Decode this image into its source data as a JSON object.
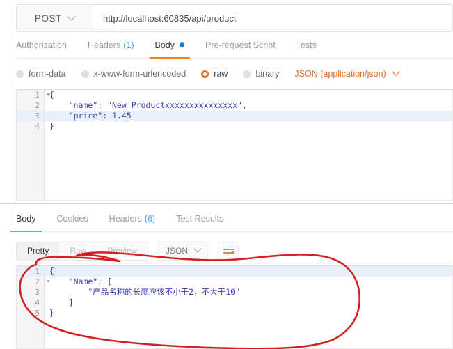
{
  "request": {
    "method": "POST",
    "method_dropdown_icon": "chevron-down-icon",
    "url": "http://localhost:60835/api/product",
    "url_placeholder": "Enter request URL",
    "tabs": [
      {
        "label": "Authorization",
        "active": false
      },
      {
        "label": "Headers",
        "count": "(1)",
        "active": false
      },
      {
        "label": "Body",
        "active": true,
        "dot": true
      },
      {
        "label": "Pre-request Script",
        "active": false
      },
      {
        "label": "Tests",
        "active": false
      }
    ],
    "body_types": [
      {
        "label": "form-data",
        "selected": false
      },
      {
        "label": "x-www-form-urlencoded",
        "selected": false
      },
      {
        "label": "raw",
        "selected": true
      },
      {
        "label": "binary",
        "selected": false
      }
    ],
    "content_type": "JSON (application/json)",
    "content_type_icon": "chevron-down-icon",
    "code_lines": [
      {
        "num": "1",
        "fold": true,
        "text": "{",
        "highlight": false
      },
      {
        "num": "2",
        "fold": false,
        "text": "    \"name\": \"New Productxxxxxxxxxxxxxxx\",",
        "highlight": false
      },
      {
        "num": "3",
        "fold": false,
        "text": "    \"price\": 1.45",
        "highlight": true
      },
      {
        "num": "4",
        "fold": false,
        "text": "}",
        "highlight": false
      }
    ]
  },
  "response": {
    "tabs": [
      {
        "label": "Body",
        "active": true
      },
      {
        "label": "Cookies",
        "active": false
      },
      {
        "label": "Headers",
        "count": "(6)",
        "active": false
      },
      {
        "label": "Test Results",
        "active": false
      }
    ],
    "view_modes": [
      {
        "label": "Pretty",
        "active": true
      },
      {
        "label": "Raw",
        "active": false
      },
      {
        "label": "Preview",
        "active": false
      }
    ],
    "format": "JSON",
    "format_icon": "chevron-down-icon",
    "wrap_button_icon": "word-wrap-icon",
    "code_lines": [
      {
        "num": "1",
        "fold": true,
        "text": "{",
        "highlight": true
      },
      {
        "num": "2",
        "fold": true,
        "text": "    \"Name\": [",
        "highlight": false
      },
      {
        "num": "3",
        "fold": false,
        "text": "        \"产品名称的长度应该不小于2，不大于10\"",
        "highlight": false
      },
      {
        "num": "4",
        "fold": false,
        "text": "    ]",
        "highlight": false
      },
      {
        "num": "5",
        "fold": false,
        "text": "}",
        "highlight": false
      }
    ]
  },
  "annotation": {
    "shape": "hand-drawn-red-ellipse",
    "color": "#d42020"
  },
  "colors": {
    "accent_orange": "#e8833a",
    "link_blue": "#4aa3df",
    "code_blue": "#3b3bbb",
    "annotation_red": "#d42020"
  }
}
